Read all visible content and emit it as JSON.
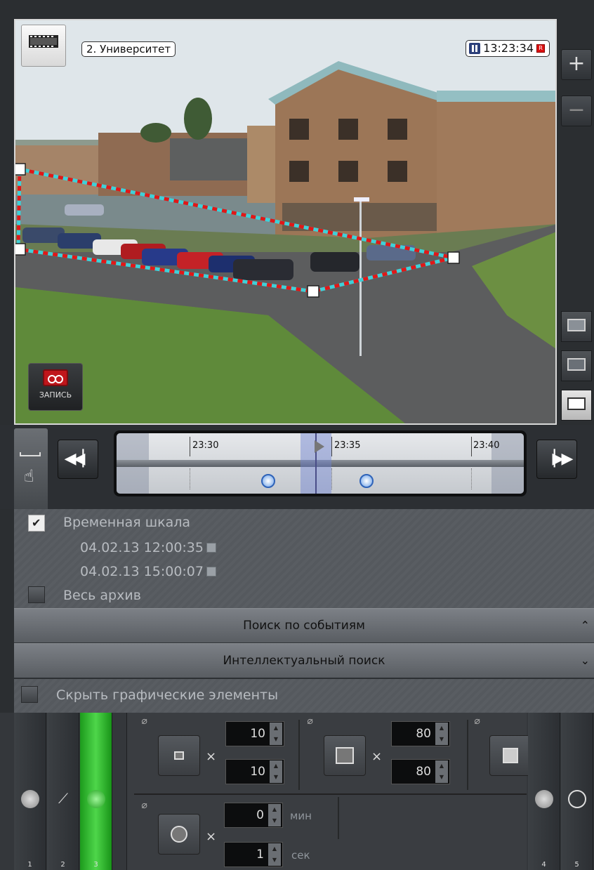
{
  "camera": {
    "name": "2. Университет",
    "time": "13:23:34",
    "rec_flag": "R",
    "record_label": "ЗАПИСЬ"
  },
  "zoom": {
    "plus": "+",
    "minus": "−"
  },
  "timeline": {
    "labels": [
      "23:30",
      "23:35",
      "23:40"
    ]
  },
  "options": {
    "timeline_label": "Временная шкала",
    "timeline_checked": true,
    "date_from": "04.02.13 12:00:35",
    "date_to": "04.02.13 15:00:07",
    "whole_archive_label": "Весь архив",
    "whole_archive_checked": false
  },
  "sections": {
    "event_search": "Поиск по событиям",
    "smart_search": "Интеллектуальный поиск"
  },
  "hide_graphics_label": "Скрыть графические элементы",
  "tools": {
    "columns": [
      "1",
      "2",
      "3",
      "4",
      "5"
    ],
    "active_column": "3",
    "min_size": {
      "w": "10",
      "h": "10"
    },
    "max_size": {
      "w": "80",
      "h": "80"
    },
    "duration": {
      "min": "0",
      "min_unit": "мин",
      "sec": "1",
      "sec_unit": "сек"
    },
    "multiply": "×"
  },
  "colors": {
    "zone_red": "#e01818",
    "zone_cyan": "#3fd0d8",
    "active_green": "#3ccc38"
  }
}
